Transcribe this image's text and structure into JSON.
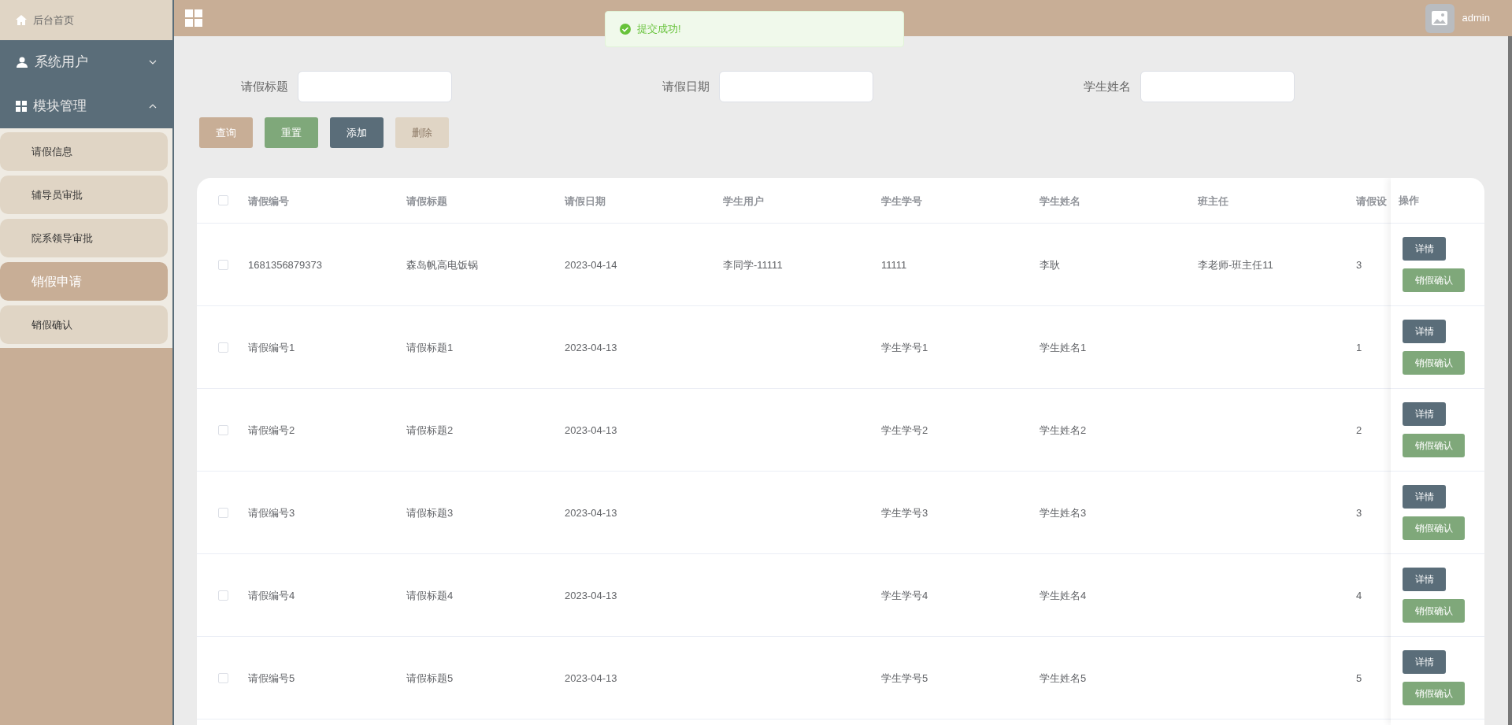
{
  "sidebar": {
    "home": {
      "label": "后台首页"
    },
    "groups": [
      {
        "label": "系统用户",
        "kind": "user",
        "expanded": false
      },
      {
        "label": "模块管理",
        "kind": "grid",
        "expanded": true,
        "items": [
          {
            "label": "请假信息",
            "selected": false
          },
          {
            "label": "辅导员审批",
            "selected": false
          },
          {
            "label": "院系领导审批",
            "selected": false
          },
          {
            "label": "销假申请",
            "selected": true
          },
          {
            "label": "销假确认",
            "selected": false
          }
        ]
      }
    ]
  },
  "topbar": {
    "toast": {
      "message": "提交成功!"
    },
    "user": {
      "name": "admin"
    }
  },
  "filters": [
    {
      "label": "请假标题"
    },
    {
      "label": "请假日期"
    },
    {
      "label": "学生姓名"
    }
  ],
  "buttons": [
    {
      "label": "查询",
      "kind": "query",
      "disabled": false
    },
    {
      "label": "重置",
      "kind": "reset",
      "disabled": false
    },
    {
      "label": "添加",
      "kind": "add",
      "disabled": false
    },
    {
      "label": "删除",
      "kind": "delete",
      "disabled": true
    }
  ],
  "table": {
    "select_all": {
      "checked": false
    },
    "columns": [
      "请假编号",
      "请假标题",
      "请假日期",
      "学生用户",
      "学生学号",
      "学生姓名",
      "班主任",
      "请假设"
    ],
    "action_column": "操作",
    "rows": [
      {
        "checked": false,
        "cells": [
          "1681356879373",
          "森岛帆高电饭锅",
          "2023-04-14",
          "李同学-11111",
          "11111",
          "李耿",
          "李老师-班主任11",
          "3"
        ],
        "actions": [
          "详情",
          "销假确认"
        ]
      },
      {
        "checked": false,
        "cells": [
          "请假编号1",
          "请假标题1",
          "2023-04-13",
          "",
          "学生学号1",
          "学生姓名1",
          "",
          "1"
        ],
        "actions": [
          "详情",
          "销假确认"
        ]
      },
      {
        "checked": false,
        "cells": [
          "请假编号2",
          "请假标题2",
          "2023-04-13",
          "",
          "学生学号2",
          "学生姓名2",
          "",
          "2"
        ],
        "actions": [
          "详情",
          "销假确认"
        ]
      },
      {
        "checked": false,
        "cells": [
          "请假编号3",
          "请假标题3",
          "2023-04-13",
          "",
          "学生学号3",
          "学生姓名3",
          "",
          "3"
        ],
        "actions": [
          "详情",
          "销假确认"
        ]
      },
      {
        "checked": false,
        "cells": [
          "请假编号4",
          "请假标题4",
          "2023-04-13",
          "",
          "学生学号4",
          "学生姓名4",
          "",
          "4"
        ],
        "actions": [
          "详情",
          "销假确认"
        ]
      },
      {
        "checked": false,
        "cells": [
          "请假编号5",
          "请假标题5",
          "2023-04-13",
          "",
          "学生学号5",
          "学生姓名5",
          "",
          "5"
        ],
        "actions": [
          "详情",
          "销假确认"
        ]
      }
    ]
  }
}
